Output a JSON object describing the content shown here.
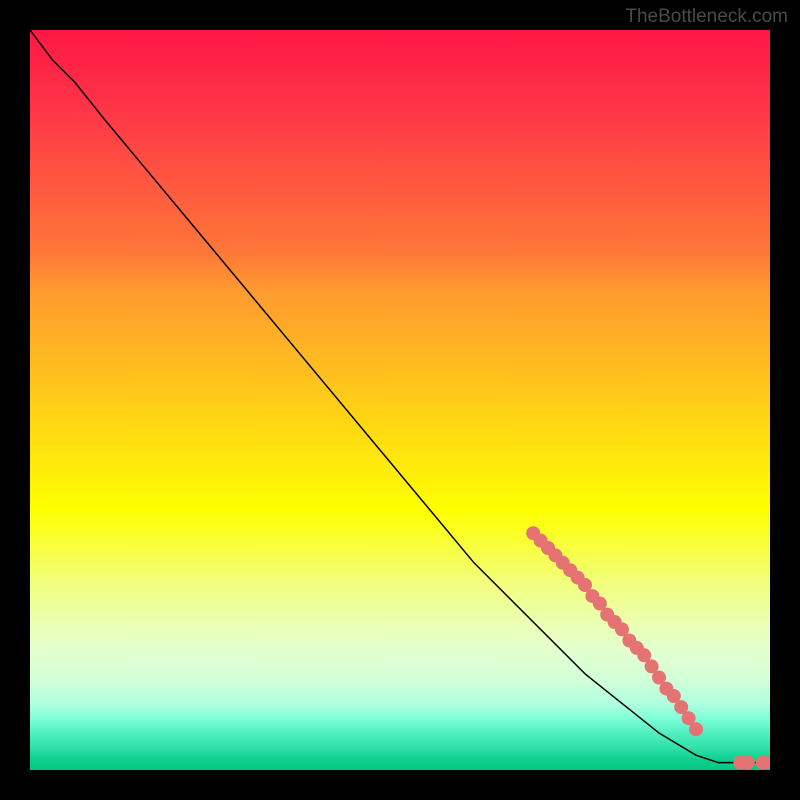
{
  "watermark": "TheBottleneck.com",
  "chart_data": {
    "type": "line",
    "title": "",
    "xlabel": "",
    "ylabel": "",
    "xlim": [
      0,
      100
    ],
    "ylim": [
      0,
      100
    ],
    "line": {
      "points": [
        {
          "x": 0,
          "y": 100
        },
        {
          "x": 3,
          "y": 96
        },
        {
          "x": 6,
          "y": 93
        },
        {
          "x": 10,
          "y": 88
        },
        {
          "x": 15,
          "y": 82
        },
        {
          "x": 20,
          "y": 76
        },
        {
          "x": 25,
          "y": 70
        },
        {
          "x": 30,
          "y": 64
        },
        {
          "x": 35,
          "y": 58
        },
        {
          "x": 40,
          "y": 52
        },
        {
          "x": 45,
          "y": 46
        },
        {
          "x": 50,
          "y": 40
        },
        {
          "x": 55,
          "y": 34
        },
        {
          "x": 60,
          "y": 28
        },
        {
          "x": 65,
          "y": 23
        },
        {
          "x": 70,
          "y": 18
        },
        {
          "x": 75,
          "y": 13
        },
        {
          "x": 80,
          "y": 9
        },
        {
          "x": 85,
          "y": 5
        },
        {
          "x": 90,
          "y": 2
        },
        {
          "x": 93,
          "y": 1
        },
        {
          "x": 95,
          "y": 1
        },
        {
          "x": 97,
          "y": 1
        },
        {
          "x": 99,
          "y": 1
        },
        {
          "x": 100,
          "y": 1
        }
      ]
    },
    "markers": [
      {
        "x": 68,
        "y": 32
      },
      {
        "x": 69,
        "y": 31
      },
      {
        "x": 70,
        "y": 30
      },
      {
        "x": 71,
        "y": 29
      },
      {
        "x": 72,
        "y": 28
      },
      {
        "x": 73,
        "y": 27
      },
      {
        "x": 74,
        "y": 26
      },
      {
        "x": 75,
        "y": 25
      },
      {
        "x": 76,
        "y": 23.5
      },
      {
        "x": 77,
        "y": 22.5
      },
      {
        "x": 78,
        "y": 21
      },
      {
        "x": 79,
        "y": 20
      },
      {
        "x": 80,
        "y": 19
      },
      {
        "x": 81,
        "y": 17.5
      },
      {
        "x": 82,
        "y": 16.5
      },
      {
        "x": 83,
        "y": 15.5
      },
      {
        "x": 84,
        "y": 14
      },
      {
        "x": 85,
        "y": 12.5
      },
      {
        "x": 86,
        "y": 11
      },
      {
        "x": 87,
        "y": 10
      },
      {
        "x": 88,
        "y": 8.5
      },
      {
        "x": 89,
        "y": 7
      },
      {
        "x": 90,
        "y": 5.5
      },
      {
        "x": 96,
        "y": 1
      },
      {
        "x": 97,
        "y": 1
      },
      {
        "x": 99,
        "y": 1
      },
      {
        "x": 100,
        "y": 1
      }
    ],
    "marker_color": "#e57373",
    "line_color": "#000000"
  }
}
